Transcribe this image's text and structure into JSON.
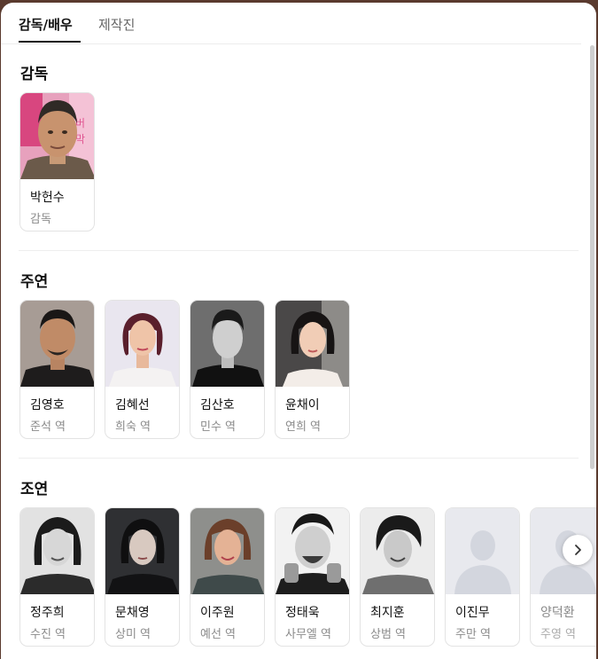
{
  "tabs": [
    {
      "label": "감독/배우",
      "active": true
    },
    {
      "label": "제작진",
      "active": false
    }
  ],
  "sections": {
    "director": {
      "title": "감독",
      "people": [
        {
          "name": "박헌수",
          "role": "감독",
          "photo": "director-photo"
        }
      ]
    },
    "lead": {
      "title": "주연",
      "people": [
        {
          "name": "김영호",
          "role": "준석 역",
          "photo": "actor-photo"
        },
        {
          "name": "김혜선",
          "role": "희숙 역",
          "photo": "actor-photo"
        },
        {
          "name": "김산호",
          "role": "민수 역",
          "photo": "actor-photo"
        },
        {
          "name": "윤채이",
          "role": "연희 역",
          "photo": "actor-photo"
        }
      ]
    },
    "supporting": {
      "title": "조연",
      "people": [
        {
          "name": "정주희",
          "role": "수진 역",
          "photo": "actor-photo"
        },
        {
          "name": "문채영",
          "role": "상미 역",
          "photo": "actor-photo"
        },
        {
          "name": "이주원",
          "role": "예선 역",
          "photo": "actor-photo"
        },
        {
          "name": "정태욱",
          "role": "사무엘 역",
          "photo": "actor-photo"
        },
        {
          "name": "최지훈",
          "role": "상범 역",
          "photo": "actor-photo"
        },
        {
          "name": "이진무",
          "role": "주만 역",
          "photo": "placeholder-avatar-icon"
        },
        {
          "name": "양덕환",
          "role": "주영 역",
          "photo": "placeholder-avatar-icon"
        }
      ]
    }
  },
  "icons": {
    "next": "chevron-right-icon"
  },
  "colors": {
    "background": "#5a3a2e",
    "card_border": "#e3e3e3",
    "role_text": "#8a8a8a"
  }
}
